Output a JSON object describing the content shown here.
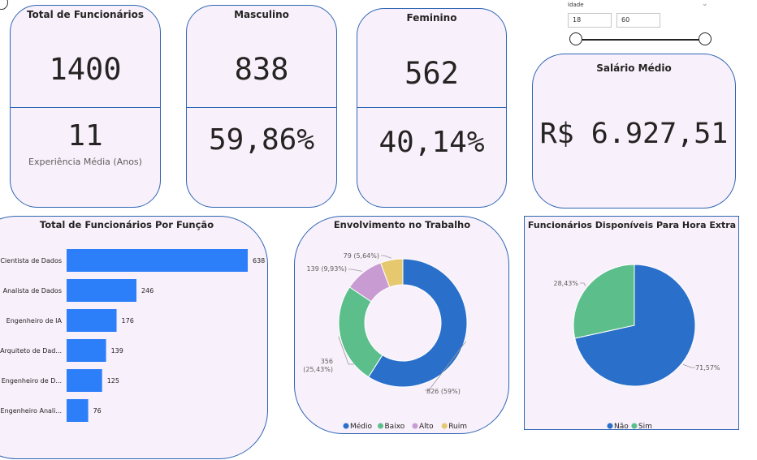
{
  "kpis": {
    "total": {
      "title": "Total de Funcionários",
      "value": "1400",
      "secondary": "11",
      "caption": "Experiência Média (Anos)"
    },
    "male": {
      "title": "Masculino",
      "value": "838",
      "secondary": "59,86%"
    },
    "female": {
      "title": "Feminino",
      "value": "562",
      "secondary": "40,14%"
    },
    "salary": {
      "title": "Salário Médio",
      "value": "R$ 6.927,51"
    }
  },
  "slicer": {
    "label": "Idade",
    "min": "18",
    "max": "60",
    "range": [
      18,
      60
    ]
  },
  "colors": {
    "blue": "#2d7ff9",
    "dark_blue": "#2a6fc9",
    "green": "#5cbf8b",
    "purple": "#c89bd3",
    "yellow": "#e6c86f",
    "border": "#2f66b3",
    "card_bg": "#f8f0fb"
  },
  "chart_data": [
    {
      "type": "bar",
      "title": "Total de Funcionários Por Função",
      "orientation": "horizontal",
      "categories": [
        "Cientista de Dados",
        "Analista de Dados",
        "Engenheiro de IA",
        "Arquiteto de Dad...",
        "Engenheiro de D...",
        "Engenheiro Anali..."
      ],
      "values": [
        638,
        246,
        176,
        139,
        125,
        76
      ],
      "labels": [
        "638",
        "246",
        "176",
        "139",
        "125",
        "76"
      ]
    },
    {
      "type": "pie",
      "variant": "donut",
      "title": "Envolvimento no Trabalho",
      "categories": [
        "Médio",
        "Baixo",
        "Alto",
        "Ruim"
      ],
      "values": [
        826,
        356,
        139,
        79
      ],
      "labels": [
        "826 (59%)",
        "356 (25,43%)",
        "139 (9,93%)",
        "79 (5,64%)"
      ],
      "legend_position": "bottom"
    },
    {
      "type": "pie",
      "title": "Funcionários Disponíveis Para Hora Extra",
      "categories": [
        "Não",
        "Sim"
      ],
      "values": [
        71.57,
        28.43
      ],
      "labels": [
        "71,57%",
        "28,43%"
      ],
      "legend_position": "bottom"
    }
  ]
}
